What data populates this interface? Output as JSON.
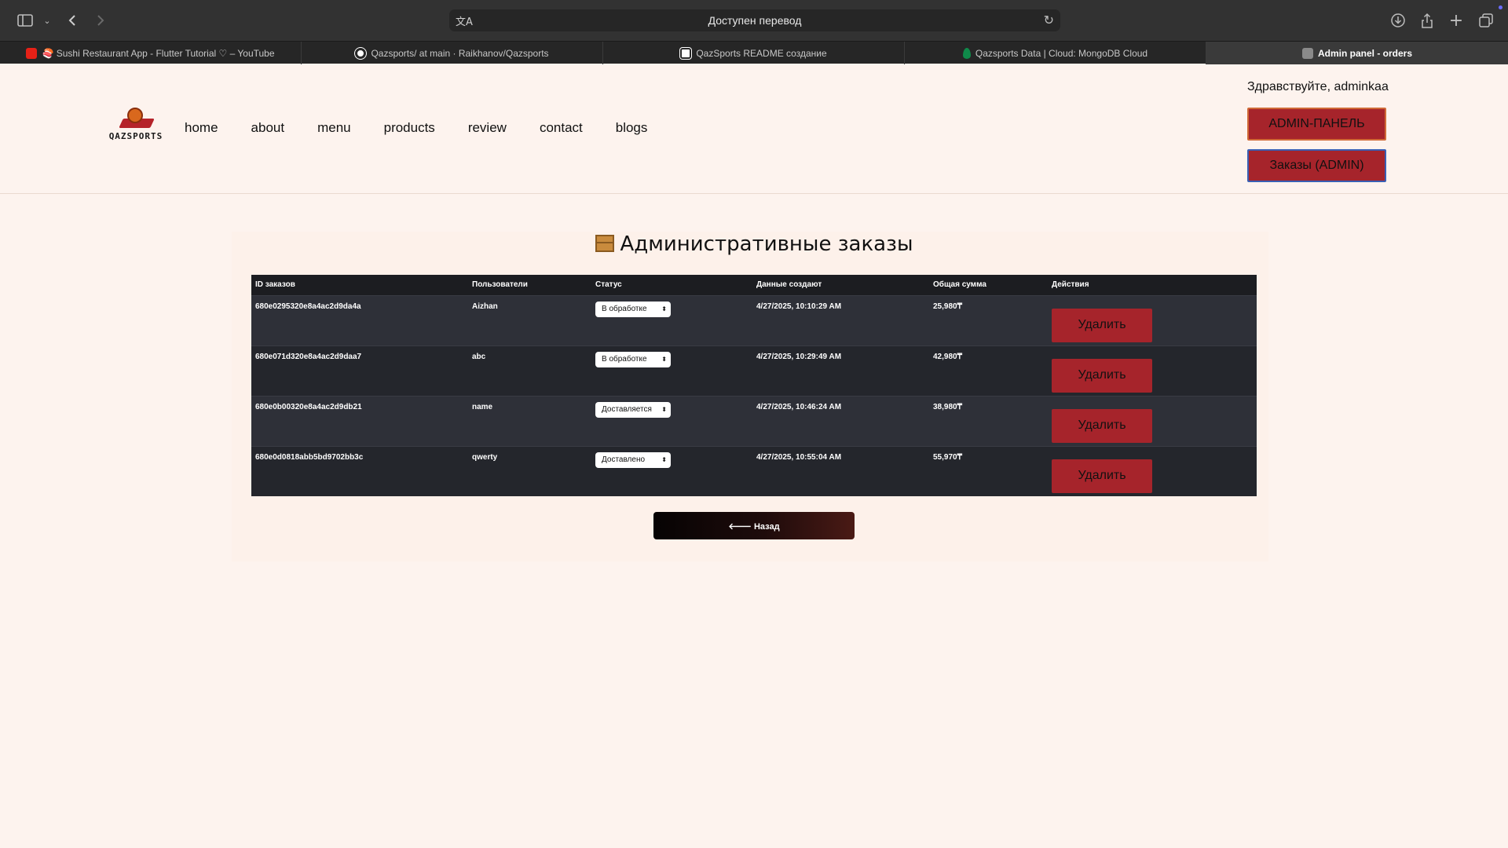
{
  "browser": {
    "address_text": "Доступен перевод",
    "tabs": [
      {
        "label": "🍣 Sushi Restaurant App - Flutter Tutorial ♡ – YouTube",
        "active": false
      },
      {
        "label": "Qazsports/ at main · Raikhanov/Qazsports",
        "active": false
      },
      {
        "label": "QazSports README создание",
        "active": false
      },
      {
        "label": "Qazsports Data | Cloud: MongoDB Cloud",
        "active": false
      },
      {
        "label": "Admin panel - orders",
        "active": true
      }
    ]
  },
  "site": {
    "logo_text": "QAZSPORTS",
    "nav": [
      "home",
      "about",
      "menu",
      "products",
      "review",
      "contact",
      "blogs"
    ],
    "greeting": "Здравствуйте, adminkaa",
    "admin_button": "ADMIN-ПАНЕЛЬ",
    "orders_button": "Заказы (ADMIN)"
  },
  "admin": {
    "title": "Административные заказы",
    "columns": [
      "ID заказов",
      "Пользователи",
      "Статус",
      "Данные создают",
      "Общая сумма",
      "Действия"
    ],
    "rows": [
      {
        "id": "680e0295320e8a4ac2d9da4a",
        "user": "Aizhan",
        "status": "В обработке",
        "created": "4/27/2025, 10:10:29 AM",
        "total": "25,980₸",
        "action": "Удалить"
      },
      {
        "id": "680e071d320e8a4ac2d9daa7",
        "user": "abc",
        "status": "В обработке",
        "created": "4/27/2025, 10:29:49 AM",
        "total": "42,980₸",
        "action": "Удалить"
      },
      {
        "id": "680e0b00320e8a4ac2d9db21",
        "user": "name",
        "status": "Доставляется",
        "created": "4/27/2025, 10:46:24 AM",
        "total": "38,980₸",
        "action": "Удалить"
      },
      {
        "id": "680e0d0818abb5bd9702bb3c",
        "user": "qwerty",
        "status": "Доставлено",
        "created": "4/27/2025, 10:55:04 AM",
        "total": "55,970₸",
        "action": "Удалить"
      }
    ],
    "back_button": "🡐 Назад"
  }
}
